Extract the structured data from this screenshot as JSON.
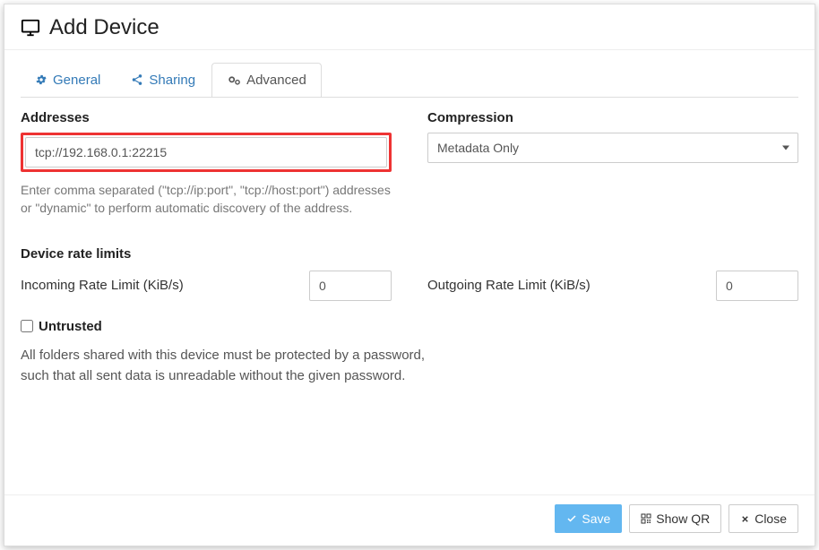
{
  "header": {
    "title": "Add Device"
  },
  "tabs": {
    "general": "General",
    "sharing": "Sharing",
    "advanced": "Advanced"
  },
  "addresses": {
    "label": "Addresses",
    "value": "tcp://192.168.0.1:22215",
    "help": "Enter comma separated (\"tcp://ip:port\", \"tcp://host:port\") addresses or \"dynamic\" to perform automatic discovery of the address."
  },
  "compression": {
    "label": "Compression",
    "selected": "Metadata Only"
  },
  "rate": {
    "section": "Device rate limits",
    "incoming_label": "Incoming Rate Limit (KiB/s)",
    "incoming_value": "0",
    "outgoing_label": "Outgoing Rate Limit (KiB/s)",
    "outgoing_value": "0"
  },
  "untrusted": {
    "label": "Untrusted",
    "checked": false,
    "help": "All folders shared with this device must be protected by a password, such that all sent data is unreadable without the given password."
  },
  "footer": {
    "save": "Save",
    "showqr": "Show QR",
    "close": "Close"
  }
}
